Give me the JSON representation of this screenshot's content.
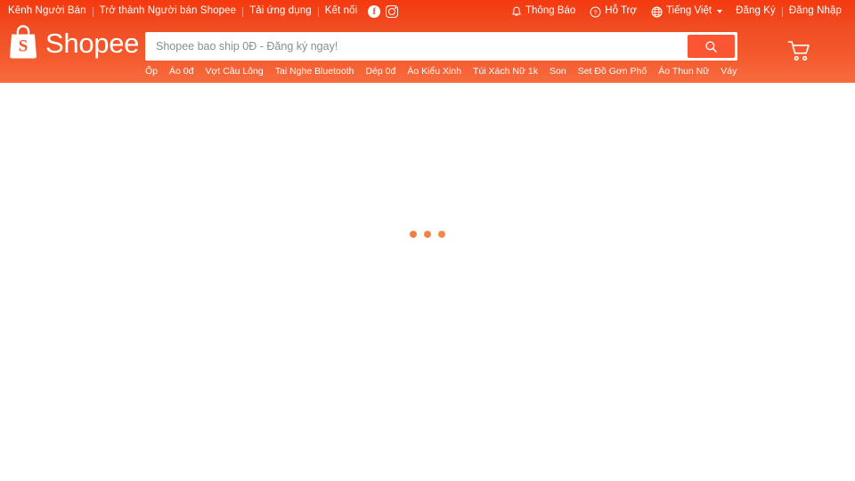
{
  "header": {
    "brand": "Shopee",
    "brand_icon": "shopee-bag-logo",
    "topbar": {
      "left_links": [
        {
          "label": "Kênh Người Bán",
          "name": "seller-channel-link"
        },
        {
          "label": "Trở thành Người bán Shopee",
          "name": "become-seller-link"
        },
        {
          "label": "Tải ứng dụng",
          "name": "download-app-link"
        }
      ],
      "connect_label": "Kết nối",
      "social": [
        {
          "name": "facebook-icon",
          "glyph": "f"
        },
        {
          "name": "instagram-icon",
          "glyph": "camera"
        }
      ],
      "right_items": [
        {
          "label": "Thông Báo",
          "icon": "bell-icon",
          "name": "notifications-link"
        },
        {
          "label": "Hỗ Trợ",
          "icon": "help-circle-icon",
          "name": "support-link"
        },
        {
          "label": "Tiếng Việt",
          "icon": "globe-icon",
          "name": "language-selector"
        }
      ],
      "auth": {
        "signup_label": "Đăng Ký",
        "login_label": "Đăng Nhập"
      }
    },
    "search": {
      "placeholder": "Shopee bao ship 0Đ - Đăng ký ngay!",
      "value": "",
      "button_icon": "search-icon"
    },
    "hot_keywords": [
      "Ốp",
      "Áo 0đ",
      "Vợt Cầu Lông",
      "Tai Nghe Bluetooth",
      "Dép 0đ",
      "Áo Kiểu Xinh",
      "Túi Xách Nữ 1k",
      "Son",
      "Set Đồ Gơn Phố",
      "Áo Thun Nữ",
      "Váy Tết"
    ],
    "cart": {
      "icon": "shopping-cart-icon",
      "count": ""
    }
  },
  "body": {
    "state": "loading",
    "loader_icon": "three-dots-loading"
  },
  "colors": {
    "brand_top": "#f4390f",
    "brand_bottom": "#f86c3f",
    "search_button": "#fb5533",
    "loader_dot": "#ee8245",
    "page_background": "#ffffff"
  }
}
